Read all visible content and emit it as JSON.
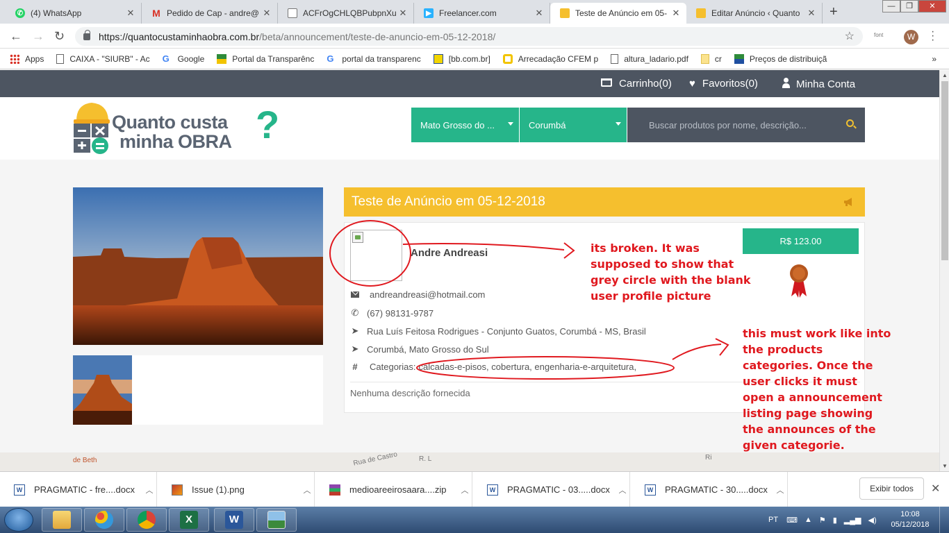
{
  "browser": {
    "tabs": [
      {
        "title": "(4) WhatsApp",
        "icon": "whatsapp-icon",
        "color": "#25d366"
      },
      {
        "title": "Pedido de Cap - andre@",
        "icon": "gmail-icon",
        "color": "#d93025"
      },
      {
        "title": "ACFrOgCHLQBPubpnXu",
        "icon": "document-icon",
        "color": "#777777"
      },
      {
        "title": "Freelancer.com",
        "icon": "freelancer-icon",
        "color": "#29b2fe"
      },
      {
        "title": "Teste de Anúncio em 05-",
        "icon": "site-icon",
        "color": "#f5bf2e"
      },
      {
        "title": "Editar Anúncio ‹ Quanto",
        "icon": "site-icon",
        "color": "#f5bf2e"
      }
    ],
    "url_host": "https://quantocustaminhaobra.com.br",
    "url_path": "/beta/announcement/teste-de-anuncio-em-05-12-2018/",
    "extension_label": "font",
    "profile_initial": "W",
    "bookmarks": [
      {
        "label": "Apps",
        "icon": "apps-grid-icon"
      },
      {
        "label": "CAIXA - \"SIURB\" - Ac",
        "icon": "page-icon"
      },
      {
        "label": "Google",
        "icon": "google-icon"
      },
      {
        "label": "Portal da Transparênc",
        "icon": "flag-icon"
      },
      {
        "label": "portal da transparenc",
        "icon": "google-icon"
      },
      {
        "label": "[bb.com.br]",
        "icon": "bb-icon"
      },
      {
        "label": "Arrecadação CFEM p",
        "icon": "circle-icon"
      },
      {
        "label": "altura_ladario.pdf",
        "icon": "page-icon"
      },
      {
        "label": "cr",
        "icon": "folder-icon"
      },
      {
        "label": "Preços de distribuiçã",
        "icon": "flag-icon"
      }
    ],
    "bookmarks_more": "»"
  },
  "site": {
    "topbar": {
      "cart": "Carrinho(0)",
      "favorites": "Favoritos(0)",
      "account": "Minha Conta"
    },
    "logo": {
      "line1": "Quanto custa",
      "line2": "minha OBRA",
      "mark": "?"
    },
    "state_select": "Mato Grosso do ...",
    "city_select": "Corumbá",
    "search_placeholder": "Buscar produtos por nome, descrição...",
    "announcement": {
      "title": "Teste de Anúncio em 05-12-2018",
      "seller": "Andre Andreasi",
      "email": "andreandreasi@hotmail.com",
      "phone": "(67) 98131-9787",
      "address": "Rua Luís Feitosa Rodrigues - Conjunto Guatos, Corumbá - MS, Brasil",
      "location": "Corumbá, Mato Grosso do Sul",
      "categories_label": "Categorias:",
      "categories": "calcadas-e-pisos, cobertura, engenharia-e-arquitetura,",
      "description": "Nenhuma descrição fornecida",
      "price": "R$ 123.00"
    },
    "map_labels": [
      "de Beth",
      "R. L",
      "Rua de Castro",
      "Ri"
    ]
  },
  "annotations": {
    "note1": [
      "its broken. It was",
      "supposed to show that",
      "grey circle with the blank",
      "user profile picture"
    ],
    "note2": [
      "this must work like into",
      "the products",
      "categories. Once the",
      "user clicks it must",
      "open a announcement",
      "listing page showing",
      "the announces of the",
      "given categorie."
    ]
  },
  "downloads": {
    "items": [
      {
        "name": "PRAGMATIC - fre....docx",
        "icon": "word-icon"
      },
      {
        "name": "Issue (1).png",
        "icon": "image-icon"
      },
      {
        "name": "medioareeirosaara....zip",
        "icon": "zip-icon"
      },
      {
        "name": "PRAGMATIC - 03.....docx",
        "icon": "word-icon"
      },
      {
        "name": "PRAGMATIC - 30.....docx",
        "icon": "word-icon"
      }
    ],
    "show_all": "Exibir todos"
  },
  "taskbar": {
    "language": "PT",
    "time": "10:08",
    "date": "05/12/2018"
  },
  "colors": {
    "accent_green": "#26b58a",
    "accent_yellow": "#f5bf2e",
    "topbar_gray": "#4d5561",
    "annotation_red": "#e0191f"
  }
}
